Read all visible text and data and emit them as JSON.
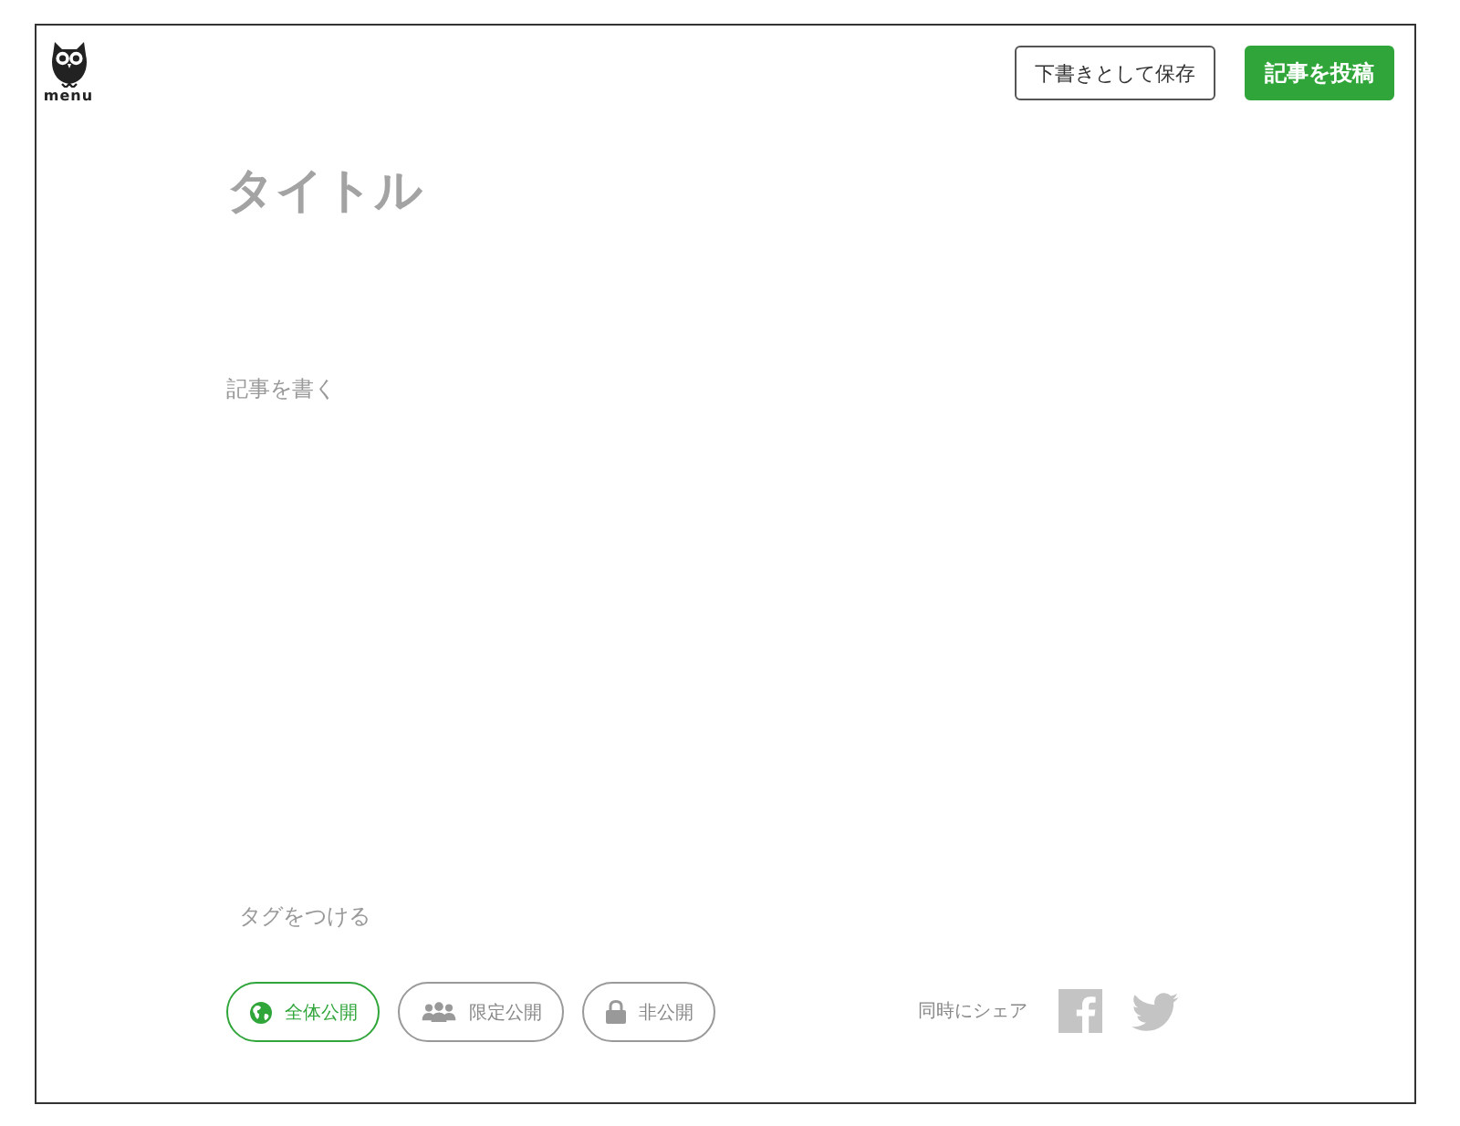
{
  "header": {
    "logo_label": "menu",
    "buttons": [
      {
        "label": "下書きとして保存",
        "kind": "outline"
      },
      {
        "label": "記事を投稿",
        "kind": "primary"
      }
    ]
  },
  "editor": {
    "title": {
      "placeholder": "タイトル"
    },
    "body": {
      "placeholder": "記事を書く"
    },
    "tags": {
      "placeholder": "タグをつける"
    }
  },
  "visibility": [
    {
      "label": "全体公開",
      "kind": "public",
      "selected": true
    },
    {
      "label": "限定公開",
      "kind": "limited",
      "selected": false
    },
    {
      "label": "非公開",
      "kind": "private",
      "selected": false
    }
  ],
  "share": {
    "label": "同時にシェア"
  }
}
